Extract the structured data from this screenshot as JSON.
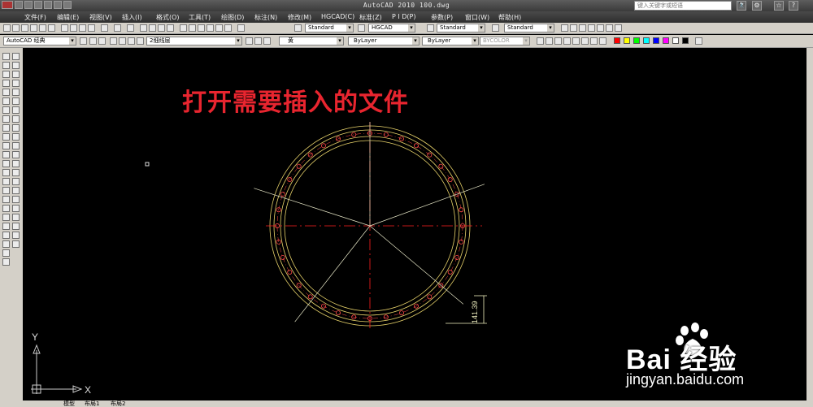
{
  "app": {
    "title": "AutoCAD 2010   100.dwg"
  },
  "search": {
    "placeholder": "键入关键字或短语"
  },
  "window_controls": [
    "?",
    "☆",
    "⚙",
    "🔭"
  ],
  "menu": [
    "文件(F)",
    "编辑(E)",
    "视图(V)",
    "插入(I)",
    "格式(O)",
    "工具(T)",
    "绘图(D)",
    "标注(N)",
    "修改(M)",
    "HGCAD(C)",
    "标准(Z)",
    "P I D(P)",
    "参数(P)",
    "窗口(W)",
    "帮助(H)"
  ],
  "toolbar2": {
    "text_style": "Standard",
    "dim_style": "HGCAD",
    "table_style": "Standard",
    "multileader_style": "Standard"
  },
  "toolbar3": {
    "workspace": "AutoCAD 经典",
    "layer": "2细线层",
    "color": "黄",
    "linetype": "ByLayer",
    "lineweight": "ByLayer",
    "plotstyle": "BYCOLOR"
  },
  "palette_colors": [
    "#ff0000",
    "#ffff00",
    "#00ff00",
    "#00ffff",
    "#0000ff",
    "#ff00ff",
    "#ffffff",
    "#000000"
  ],
  "overlay": {
    "caption": "打开需要插入的文件"
  },
  "drawing": {
    "dimension_value": "141.39",
    "ucs_y": "Y",
    "ucs_x": "X",
    "bolt_hole_count": 36,
    "colors": {
      "outer_ring": "#e8d36a",
      "holes": "#ff4a4a",
      "center_lines": "#ff2020",
      "construction": "#e8e8c8",
      "dimension": "#f0f0c0"
    }
  },
  "layout_tabs": [
    "模型",
    "布局1",
    "布局2"
  ],
  "watermark": {
    "brand": "Bai 经验",
    "url": "jingyan.baidu.com"
  }
}
